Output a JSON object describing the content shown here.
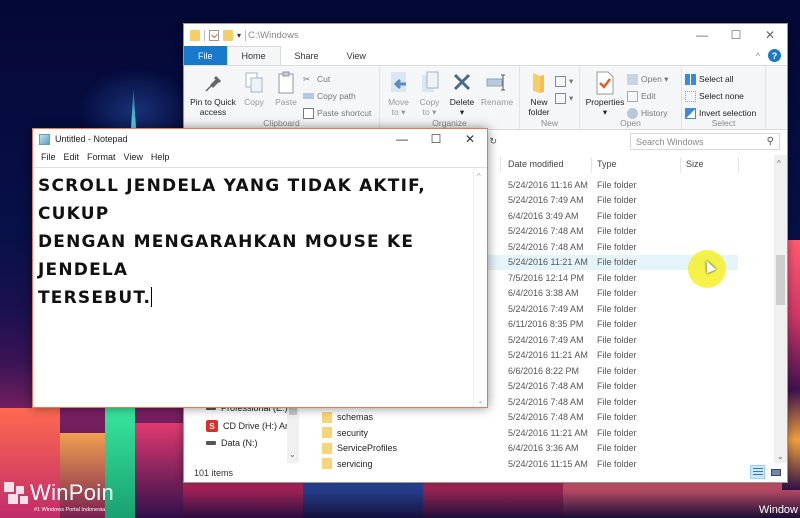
{
  "desktop": {
    "watermark_brand": "WinPoin",
    "watermark_tagline": "#1 Windows Portal Indonesia",
    "taskbar_partial_text": "Window"
  },
  "explorer": {
    "title": "C:\\Windows",
    "window_controls": {
      "minimize": "—",
      "maximize": "☐",
      "close": "✕"
    },
    "tabs": [
      {
        "label": "File",
        "type": "file"
      },
      {
        "label": "Home",
        "active": true
      },
      {
        "label": "Share"
      },
      {
        "label": "View"
      }
    ],
    "help_label": "?",
    "ribbon": {
      "clipboard": {
        "label": "Clipboard",
        "pin": "Pin to Quick access",
        "pin_line1": "Pin to Quick",
        "pin_line2": "access",
        "copy": "Copy",
        "paste": "Paste",
        "cut": "Cut",
        "copy_path": "Copy path",
        "paste_shortcut": "Paste shortcut"
      },
      "organize": {
        "label": "Organize",
        "move_to_1": "Move",
        "move_to_2": "to ▾",
        "copy_to_1": "Copy",
        "copy_to_2": "to ▾",
        "delete": "Delete",
        "delete_caret": "▾",
        "rename": "Rename"
      },
      "new": {
        "label": "New",
        "new_folder_1": "New",
        "new_folder_2": "folder"
      },
      "open": {
        "label": "Open",
        "properties": "Properties",
        "properties_caret": "▾",
        "open": "Open ▾",
        "edit": "Edit",
        "history": "History"
      },
      "select": {
        "label": "Select",
        "select_all": "Select all",
        "select_none": "Select none",
        "invert_selection": "Invert selection"
      }
    },
    "address": {
      "dropdown_icon": "⌄",
      "refresh_icon": "↻"
    },
    "search": {
      "placeholder": "Search Windows",
      "icon": "⚲"
    },
    "nav_pane": {
      "items": [
        {
          "label": "Professional (E:)",
          "icon": "drive"
        },
        {
          "label": "CD Drive (H:) An",
          "icon": "cd"
        },
        {
          "label": "Data (N:)",
          "icon": "drive"
        }
      ]
    },
    "columns": {
      "date": "Date modified",
      "type": "Type",
      "size": "Size"
    },
    "rows": [
      {
        "name": "",
        "date": "5/24/2016 11:16 AM",
        "type": "File folder"
      },
      {
        "name": "",
        "date": "5/24/2016 7:49 AM",
        "type": "File folder"
      },
      {
        "name": "",
        "date": "6/4/2016 3:49 AM",
        "type": "File folder"
      },
      {
        "name": "",
        "date": "5/24/2016 7:48 AM",
        "type": "File folder"
      },
      {
        "name": "",
        "date": "5/24/2016 7:48 AM",
        "type": "File folder"
      },
      {
        "name": "",
        "date": "5/24/2016 11:21 AM",
        "type": "File folder",
        "hover": true
      },
      {
        "name": "",
        "date": "7/5/2016 12:14 PM",
        "type": "File folder"
      },
      {
        "name": "",
        "date": "6/4/2016 3:38 AM",
        "type": "File folder"
      },
      {
        "name": "",
        "date": "5/24/2016 7:49 AM",
        "type": "File folder"
      },
      {
        "name": "",
        "date": "6/11/2016 8:35 PM",
        "type": "File folder"
      },
      {
        "name": "",
        "date": "5/24/2016 7:49 AM",
        "type": "File folder"
      },
      {
        "name": "",
        "date": "5/24/2016 11:21 AM",
        "type": "File folder"
      },
      {
        "name": "",
        "date": "6/6/2016 8:22 PM",
        "type": "File folder"
      },
      {
        "name": "",
        "date": "5/24/2016 7:48 AM",
        "type": "File folder"
      },
      {
        "name": "",
        "date": "5/24/2016 7:48 AM",
        "type": "File folder"
      },
      {
        "name": "schemas",
        "date": "5/24/2016 7:48 AM",
        "type": "File folder"
      },
      {
        "name": "security",
        "date": "5/24/2016 11:21 AM",
        "type": "File folder"
      },
      {
        "name": "ServiceProfiles",
        "date": "6/4/2016 3:36 AM",
        "type": "File folder"
      },
      {
        "name": "servicing",
        "date": "5/24/2016 11:15 AM",
        "type": "File folder"
      }
    ],
    "status": {
      "item_count": "101 items"
    }
  },
  "notepad": {
    "title": "Untitled - Notepad",
    "window_controls": {
      "minimize": "—",
      "maximize": "☐",
      "close": "✕"
    },
    "menu": [
      "File",
      "Edit",
      "Format",
      "View",
      "Help"
    ],
    "text": "Scroll jendela yang tidak aktif, cukup\ndengan mengarahkan mouse ke jendela\ntersebut."
  },
  "colors": {
    "file_tab": "#1979ca",
    "hover_row": "#e5f3fb",
    "notepad_border": "#e07b55",
    "cursor_highlight": "#f5f028"
  }
}
